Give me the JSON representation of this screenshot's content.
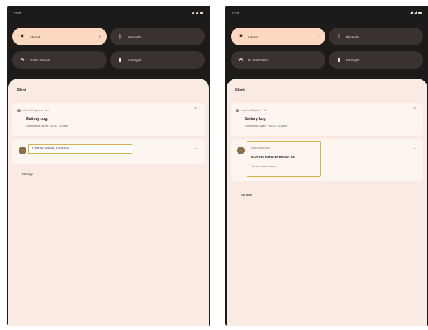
{
  "status_bar": {
    "time": "12:00"
  },
  "quick_settings": {
    "tiles": [
      {
        "label": "Internet",
        "icon": "wifi-icon",
        "active": true
      },
      {
        "label": "Bluetooth",
        "icon": "bluetooth-icon",
        "active": false
      },
      {
        "label": "Do Not Disturb",
        "icon": "do-not-disturb-icon",
        "active": false
      },
      {
        "label": "Flashlight",
        "icon": "flashlight-icon",
        "active": false
      }
    ]
  },
  "notifications": {
    "section_title": "Silent",
    "bug_report": {
      "app": "Android System · 1m",
      "title": "Battery bug",
      "text": "Screenshot taken · 00:00 · 100MB"
    },
    "usb": {
      "collapsed_text": "USB file transfer turned on",
      "app": "Android System",
      "title": "USB file transfer turned on",
      "subtitle": "Tap for more options"
    },
    "manage_label": "Manage"
  },
  "colors": {
    "background": "#1c1b1a",
    "active_tile": "#fbd8bf",
    "inactive_tile": "#3a322f",
    "sheet": "#f9ebe3",
    "highlight": "#d8b14a"
  }
}
